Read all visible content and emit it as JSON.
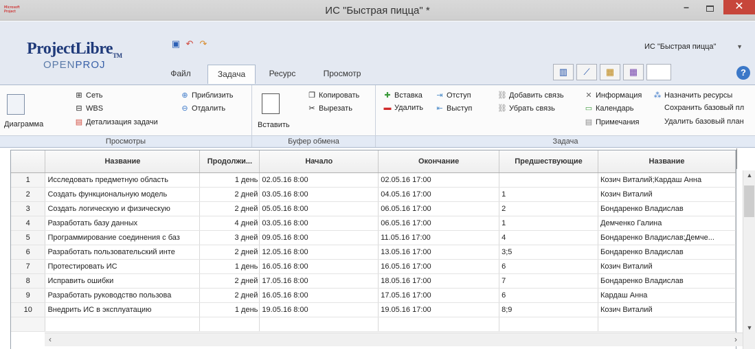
{
  "window": {
    "title": "ИС \"Быстрая пицца\" *",
    "app_icon_text": "Microsoft Project",
    "minimize_glyph": "–",
    "close_glyph": "✕"
  },
  "logo": {
    "top": "ProjectLibre",
    "tm": "TM",
    "bottom_left": "OPEN",
    "bottom_right": "PROJ"
  },
  "context_select": {
    "value": "ИС \"Быстрая пицца\""
  },
  "tabs": [
    {
      "label": "Файл"
    },
    {
      "label": "Задача"
    },
    {
      "label": "Ресурс"
    },
    {
      "label": "Просмотр"
    }
  ],
  "help_glyph": "?",
  "ribbon": {
    "views": {
      "label": "Просмотры",
      "diagram": "Диаграмма",
      "network": "Сеть",
      "wbs": "WBS",
      "task_detail": "Детализация задачи",
      "zoom_in": "Приблизить",
      "zoom_out": "Отдалить"
    },
    "clipboard": {
      "label": "Буфер обмена",
      "paste": "Вставить",
      "copy": "Копировать",
      "cut": "Вырезать"
    },
    "task": {
      "label": "Задача",
      "insert": "Вставка",
      "delete": "Удалить",
      "indent": "Отступ",
      "outdent": "Выступ",
      "add_link": "Добавить связь",
      "remove_link": "Убрать связь",
      "info": "Информация",
      "calendar": "Календарь",
      "notes": "Примечания",
      "assign_resources": "Назначить ресурсы",
      "save_baseline": "Сохранить базовый пл",
      "delete_baseline": "Удалить базовый план"
    }
  },
  "grid": {
    "columns": [
      "",
      "Название",
      "Продолжи...",
      "Начало",
      "Окончание",
      "Предшествующие",
      "Название"
    ],
    "rows": [
      [
        "1",
        "Исследовать предметную область",
        "1 день",
        "02.05.16 8:00",
        "02.05.16 17:00",
        "",
        "Козич Виталий;Кардаш Анна"
      ],
      [
        "2",
        "Создать функциональную модель",
        "2 дней",
        "03.05.16 8:00",
        "04.05.16 17:00",
        "1",
        "Козич Виталий"
      ],
      [
        "3",
        "Создать логическую и физическую",
        "2 дней",
        "05.05.16 8:00",
        "06.05.16 17:00",
        "2",
        "Бондаренко Владислав"
      ],
      [
        "4",
        "Разработать базу данных",
        "4 дней",
        "03.05.16 8:00",
        "06.05.16 17:00",
        "1",
        "Демченко Галина"
      ],
      [
        "5",
        "Программирование соединения с баз",
        "3 дней",
        "09.05.16 8:00",
        "11.05.16 17:00",
        "4",
        "Бондаренко Владислав;Демче..."
      ],
      [
        "6",
        "Разработать пользовательский инте",
        "2 дней",
        "12.05.16 8:00",
        "13.05.16 17:00",
        "3;5",
        "Бондаренко Владислав"
      ],
      [
        "7",
        "Протестировать ИС",
        "1 день",
        "16.05.16 8:00",
        "16.05.16 17:00",
        "6",
        "Козич Виталий"
      ],
      [
        "8",
        "Исправить ошибки",
        "2 дней",
        "17.05.16 8:00",
        "18.05.16 17:00",
        "7",
        "Бондаренко Владислав"
      ],
      [
        "9",
        "Разработать руководство пользова",
        "2 дней",
        "16.05.16 8:00",
        "17.05.16 17:00",
        "6",
        "Кардаш Анна"
      ],
      [
        "10",
        "Внедрить ИС в эксплуатацию",
        "1 день",
        "19.05.16 8:00",
        "19.05.16 17:00",
        "8;9",
        "Козич Виталий"
      ]
    ]
  }
}
